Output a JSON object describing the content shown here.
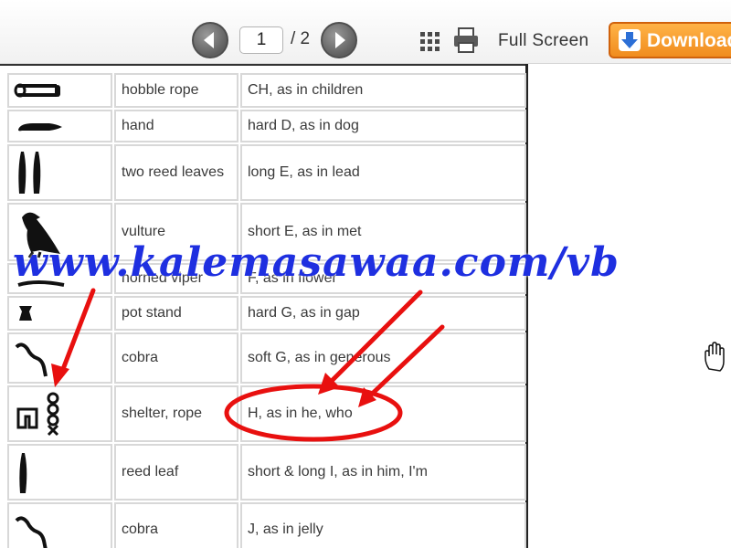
{
  "toolbar": {
    "page_current": "1",
    "page_total": "/ 2",
    "fullscreen_label": "Full Screen",
    "download_label": "Download",
    "prev_icon": "chevron-left-icon",
    "next_icon": "chevron-right-icon",
    "grid_icon": "grid-icon",
    "print_icon": "printer-icon",
    "download_icon": "download-arrow-icon",
    "accent_color": "#f08c1e"
  },
  "table": {
    "rows": [
      {
        "glyph": "hobble-rope-glyph",
        "name": "hobble rope",
        "sound": "CH, as in children"
      },
      {
        "glyph": "hand-glyph",
        "name": "hand",
        "sound": "hard D, as in dog"
      },
      {
        "glyph": "two-reed-leaves-glyph",
        "name": "two reed leaves",
        "sound": "long E, as in lead"
      },
      {
        "glyph": "vulture-glyph",
        "name": "vulture",
        "sound": "short E, as in met"
      },
      {
        "glyph": "horned-viper-glyph",
        "name": "horned viper",
        "sound": "F, as in flower"
      },
      {
        "glyph": "pot-stand-glyph",
        "name": "pot stand",
        "sound": "hard G, as in gap"
      },
      {
        "glyph": "cobra-glyph",
        "name": "cobra",
        "sound": "soft G, as in generous"
      },
      {
        "glyph": "shelter-rope-glyph",
        "name": "shelter, rope",
        "sound": "H, as in he, who"
      },
      {
        "glyph": "reed-leaf-glyph",
        "name": "reed leaf",
        "sound": "short & long I, as in him, I'm"
      },
      {
        "glyph": "cobra-glyph",
        "name": "cobra",
        "sound": "J, as in jelly"
      }
    ]
  },
  "watermark": {
    "text": "www.kalemasawaa.com/vb",
    "color": "#1e2fe0"
  },
  "annotation_color": "#e8100f"
}
